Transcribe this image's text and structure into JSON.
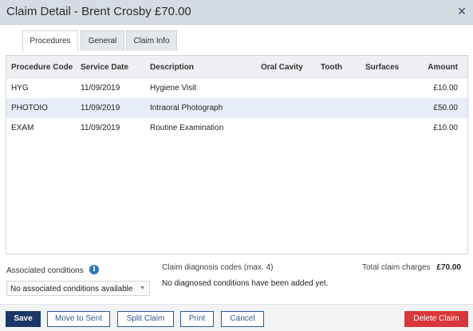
{
  "dialog": {
    "title": "Claim Detail - Brent Crosby £70.00",
    "close_glyph": "✕"
  },
  "tabs": [
    {
      "label": "Procedures",
      "active": true
    },
    {
      "label": "General",
      "active": false
    },
    {
      "label": "Claim Info",
      "active": false
    }
  ],
  "table": {
    "columns": [
      "Procedure Code",
      "Service Date",
      "Description",
      "Oral Cavity",
      "Tooth",
      "Surfaces",
      "Amount"
    ],
    "rows": [
      {
        "code": "HYG",
        "date": "11/09/2019",
        "description": "Hygiene Visit",
        "oral_cavity": "",
        "tooth": "",
        "surfaces": "",
        "amount": "£10.00"
      },
      {
        "code": "PHOTOIO",
        "date": "11/09/2019",
        "description": "Intraoral Photograph",
        "oral_cavity": "",
        "tooth": "",
        "surfaces": "",
        "amount": "£50.00"
      },
      {
        "code": "EXAM",
        "date": "11/09/2019",
        "description": "Routine Examination",
        "oral_cavity": "",
        "tooth": "",
        "surfaces": "",
        "amount": "£10.00"
      }
    ]
  },
  "associated": {
    "label": "Associated conditions",
    "info_glyph": "i",
    "selected": "No associated conditions available",
    "caret_glyph": "▼"
  },
  "diagnosis": {
    "label": "Claim diagnosis codes (max. 4)",
    "empty_text": "No diagnosed conditions have been added yet."
  },
  "totals": {
    "label": "Total claim charges",
    "value": "£70.00"
  },
  "footer": {
    "save": "Save",
    "move_to_sent": "Move to Sent",
    "split_claim": "Split Claim",
    "print": "Print",
    "cancel": "Cancel",
    "delete_claim": "Delete Claim"
  },
  "colors": {
    "titlebar": "#d6dce3",
    "primary": "#1c3766",
    "danger": "#d9373a",
    "selected_row": "#e8eef8"
  }
}
